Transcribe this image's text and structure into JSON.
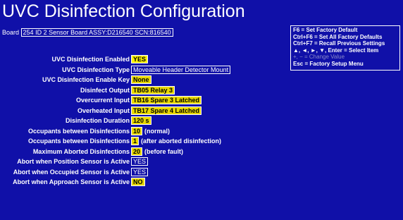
{
  "title": "UVC Disinfection Configuration",
  "board": {
    "label": "Board",
    "value": "254 ID 2 Sensor Board ASSY:D216540 SCN:816540"
  },
  "help_lines": [
    "F6 = Set Factory Default",
    "Ctrl+F6 = Set All Factory Defaults",
    "Ctrl+F7 = Recall Previous Settings",
    "▲, ◄, ►, ▼, Enter = Select Item",
    "+, − = Change Value",
    "Esc = Factory Setup Menu"
  ],
  "settings": [
    {
      "label": "UVC Disinfection Enabled",
      "value": "YES",
      "note": ""
    },
    {
      "label": "UVC Disinfection Type",
      "value": "Moveable Header Detector Mount",
      "note": ""
    },
    {
      "label": "UVC Disinfection Enable Key",
      "value": "None",
      "note": ""
    },
    {
      "label": "Disinfect Output",
      "value": "TB05 Relay 3",
      "note": ""
    },
    {
      "label": "Overcurrent Input",
      "value": "TB16 Spare 3 Latched",
      "note": ""
    },
    {
      "label": "Overheated Input",
      "value": "TB17 Spare 4 Latched",
      "note": ""
    },
    {
      "label": "Disinfection Duration",
      "value": "120 s",
      "note": ""
    },
    {
      "label": "Occupants between Disinfections",
      "value": "10",
      "note": "(normal)"
    },
    {
      "label": "Occupants between Disinfections",
      "value": "1",
      "note": "(after aborted disinfection)"
    },
    {
      "label": "Maximum Aborted Disinfections",
      "value": "20",
      "note": "(before fault)"
    },
    {
      "label": "Abort when Position Sensor is Active",
      "value": "YES",
      "note": ""
    },
    {
      "label": "Abort when Occupied Sensor is Active",
      "value": "YES",
      "note": ""
    },
    {
      "label": "Abort when Approach Sensor is Active",
      "value": "NO",
      "note": ""
    }
  ]
}
